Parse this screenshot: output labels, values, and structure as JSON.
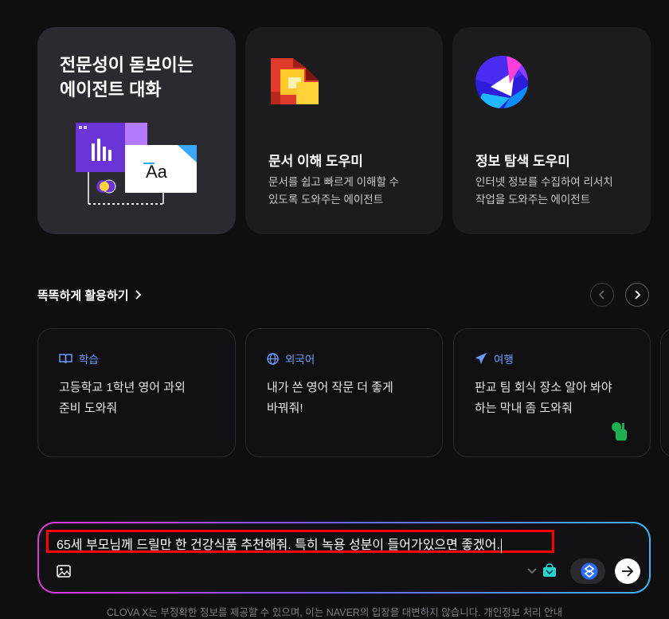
{
  "cards": [
    {
      "title": "전문성이 돋보이는\n에이전트 대화",
      "icon": "chat-agent-illustration"
    },
    {
      "title": "문서 이해 도우미",
      "desc": "문서를 쉽고 빠르게 이해할 수\n있도록 도와주는 에이전트",
      "icon": "document-agent-icon"
    },
    {
      "title": "정보 탐색 도우미",
      "desc": "인터넷 정보를 수집하여 리서치\n작업을 도와주는 에이전트",
      "icon": "search-agent-icon"
    }
  ],
  "illustration_text": "Aa",
  "section": {
    "title": "똑똑하게 활용하기"
  },
  "suggestions": [
    {
      "category": "학습",
      "icon": "book-icon",
      "text": "고등학교 1학년 영어 과외\n준비 도와줘"
    },
    {
      "category": "외국어",
      "icon": "globe-icon",
      "text": "내가 쓴 영어 작문 더 좋게\n바꿔줘!"
    },
    {
      "category": "여행",
      "icon": "airplane-icon",
      "text": "판교 팀 회식 장소 알아 봐야\n하는 막내 좀 도와줘"
    }
  ],
  "input": {
    "value": "65세 부모님께 드릴만 한 건강식품 추천해줘. 특히 녹용 성분이 들어가있으면 좋겠어."
  },
  "footer": "CLOVA X는 부정확한 정보를 제공할 수 있으며, 이는 NAVER의 입장을 대변하지 않습니다. 개인정보 처리 안내",
  "colors": {
    "accent_blue": "#6a9cff",
    "highlight_red": "#ff0000"
  }
}
